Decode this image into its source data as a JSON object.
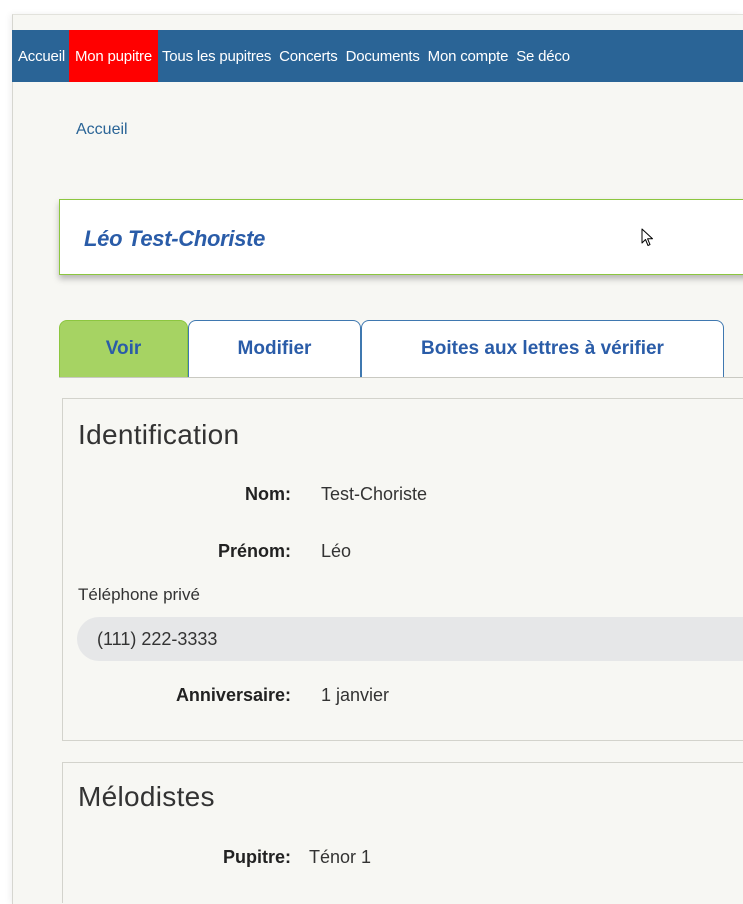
{
  "nav": {
    "items": [
      {
        "label": "Accueil",
        "active": false
      },
      {
        "label": "Mon pupitre",
        "active": true
      },
      {
        "label": "Tous les pupitres",
        "active": false
      },
      {
        "label": "Concerts",
        "active": false
      },
      {
        "label": "Documents",
        "active": false
      },
      {
        "label": "Mon compte",
        "active": false
      },
      {
        "label": "Se déco",
        "active": false
      }
    ]
  },
  "breadcrumb": {
    "home": "Accueil"
  },
  "page": {
    "title": "Léo Test-Choriste"
  },
  "tabs": [
    {
      "label": "Voir",
      "active": true
    },
    {
      "label": "Modifier",
      "active": false
    },
    {
      "label": "Boites aux lettres à vérifier",
      "active": false
    }
  ],
  "identification": {
    "heading": "Identification",
    "nom_label": "Nom:",
    "nom_value": "Test-Choriste",
    "prenom_label": "Prénom:",
    "prenom_value": "Léo",
    "telephone_label": "Téléphone privé",
    "telephone_value": "(111) 222-3333",
    "anniversaire_label": "Anniversaire:",
    "anniversaire_value": "1 janvier"
  },
  "melodistes": {
    "heading": "Mélodistes",
    "pupitre_label": "Pupitre:",
    "pupitre_value": "Ténor 1"
  },
  "colors": {
    "nav_bg": "#2a6496",
    "nav_active": "#ff0000",
    "accent_green": "#8cc63f",
    "tab_active_bg": "#a6d363",
    "link_blue": "#2a5ca8"
  },
  "icons": {
    "cursor": "mouse-pointer-icon"
  }
}
